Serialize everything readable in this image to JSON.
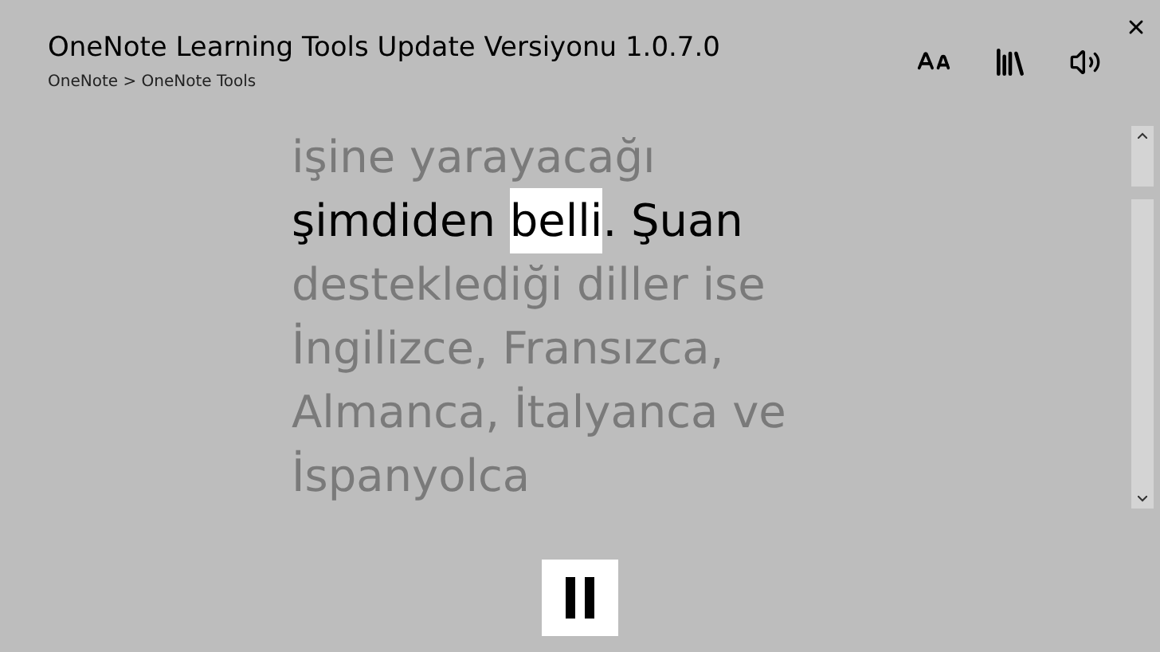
{
  "window": {
    "title": "OneNote Learning Tools Update Versiyonu 1.0.7.0",
    "breadcrumb": "OneNote > OneNote Tools"
  },
  "reader": {
    "lines": [
      {
        "current": false,
        "segments": [
          {
            "text": "işine yarayacağı",
            "highlighted": false
          }
        ]
      },
      {
        "current": true,
        "segments": [
          {
            "text": "şimdiden ",
            "highlighted": false
          },
          {
            "text": "belli",
            "highlighted": true
          },
          {
            "text": ". Şuan",
            "highlighted": false
          }
        ]
      },
      {
        "current": false,
        "segments": [
          {
            "text": "desteklediği diller ise",
            "highlighted": false
          }
        ]
      },
      {
        "current": false,
        "segments": [
          {
            "text": "İngilizce, Fransızca,",
            "highlighted": false
          }
        ]
      },
      {
        "current": false,
        "segments": [
          {
            "text": "Almanca, İtalyanca ve",
            "highlighted": false
          }
        ]
      },
      {
        "current": false,
        "segments": [
          {
            "text": "İspanyolca",
            "highlighted": false
          }
        ]
      }
    ]
  },
  "player": {
    "playing": true
  }
}
